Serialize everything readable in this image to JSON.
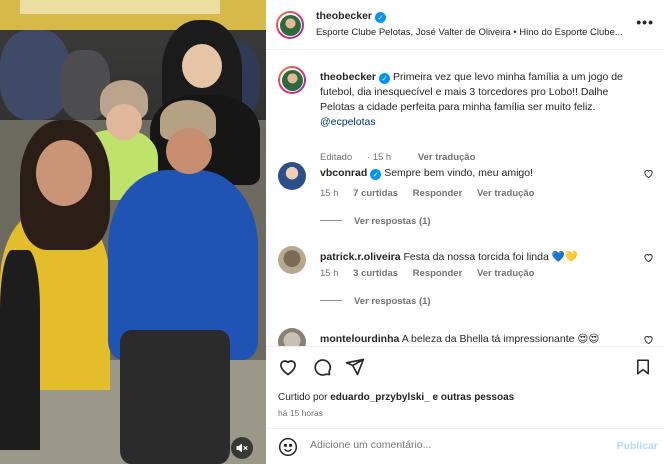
{
  "post": {
    "author": "theobecker",
    "location": "Esporte Clube Pelotas, José Valter de Oliveira • Hino do Esporte Clube...",
    "more_label": "•••"
  },
  "caption": {
    "username": "theobecker",
    "text": "Primeira vez que levo minha família a um jogo de futebol, dia inesquecível e mais 3 torcedores pro Lobo!! Dalhe Pelotas a cidade perfeita para minha família ser muito feliz.",
    "mention": "@ecpelotas",
    "edited": "Editado",
    "age": "15 h",
    "translate": "Ver tradução"
  },
  "comments": [
    {
      "username": "vbconrad",
      "text": "Sempre bem vindo, meu amigo!",
      "age": "15 h",
      "likes": "7 curtidas",
      "reply": "Responder",
      "translate": "Ver tradução",
      "view_replies": "Ver respostas (1)"
    },
    {
      "username": "patrick.r.oliveira",
      "text": "Festa da nossa torcida foi linda 💙💛",
      "age": "15 h",
      "likes": "3 curtidas",
      "reply": "Responder",
      "translate": "Ver tradução",
      "view_replies": "Ver respostas (1)"
    },
    {
      "username": "montelourdinha",
      "text": "A beleza da Bhella tá impressionante 😍😍"
    }
  ],
  "likes_line": {
    "prefix": "Curtido por",
    "user": "eduardo_przybylski_",
    "suffix": "e outras pessoas"
  },
  "timestamp": "há 15 horas",
  "add_comment": {
    "placeholder": "Adicione um comentário...",
    "post_label": "Publicar"
  },
  "colors": {
    "verified": "#0095f6",
    "link": "#00376b",
    "post_disabled": "#b3dbff"
  },
  "icons": [
    "heart-icon",
    "comment-icon",
    "share-icon",
    "bookmark-icon",
    "emoji-icon",
    "mute-icon",
    "more-icon",
    "verified-icon"
  ]
}
